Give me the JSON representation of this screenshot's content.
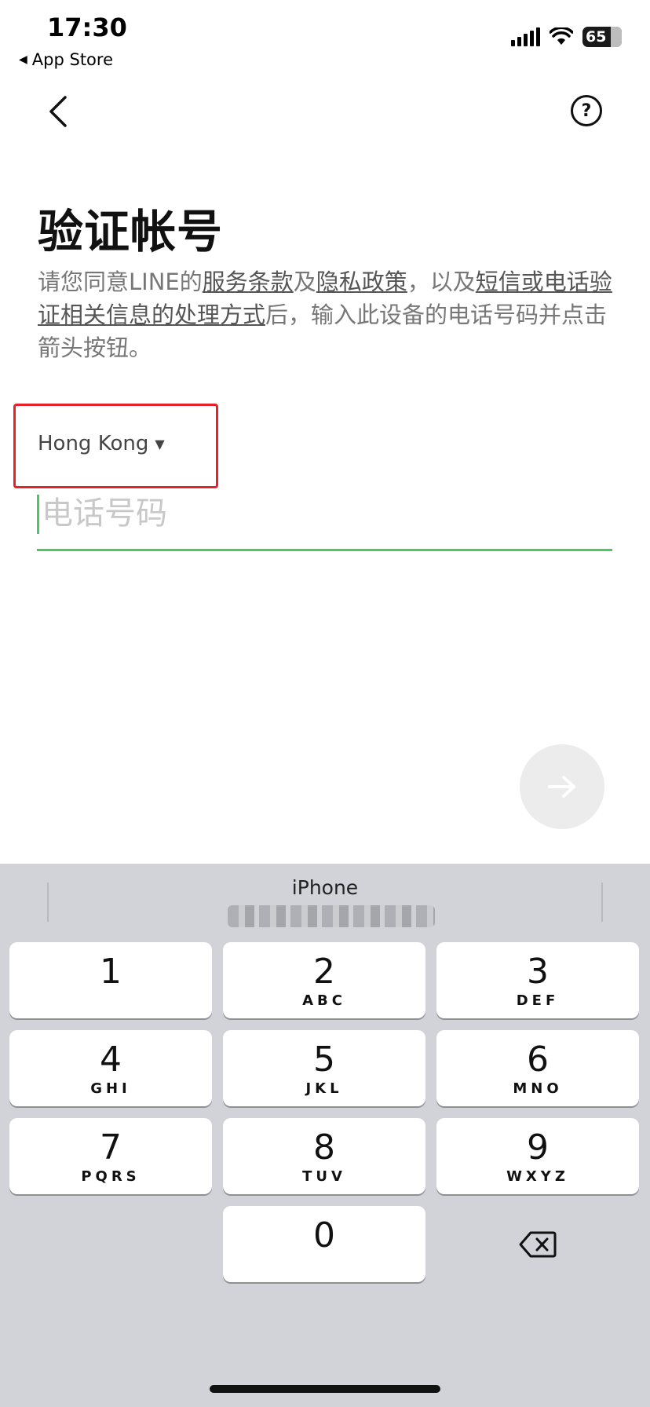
{
  "status_bar": {
    "time": "17:30",
    "back_app": "App Store",
    "battery": "65"
  },
  "nav": {
    "back_icon": "chevron-left-icon",
    "help_label": "?"
  },
  "page": {
    "title": "验证帐号",
    "desc_1": "请您同意LINE的",
    "link_terms": "服务条款",
    "desc_2": "及",
    "link_privacy": "隐私政策",
    "desc_3": "，以及",
    "link_sms": "短信或电话验证相关信息的处理方式",
    "desc_4": "后，输入此设备的电话号码并点击箭头按钮。"
  },
  "country": {
    "selected": "Hong Kong",
    "arrow": "▼"
  },
  "phone": {
    "placeholder": "电话号码",
    "value": ""
  },
  "colors": {
    "accent": "#4cc764",
    "highlight": "#e8202a"
  },
  "keyboard": {
    "suggestion_title": "iPhone",
    "keys": [
      {
        "digit": "1",
        "letters": ""
      },
      {
        "digit": "2",
        "letters": "ABC"
      },
      {
        "digit": "3",
        "letters": "DEF"
      },
      {
        "digit": "4",
        "letters": "GHI"
      },
      {
        "digit": "5",
        "letters": "JKL"
      },
      {
        "digit": "6",
        "letters": "MNO"
      },
      {
        "digit": "7",
        "letters": "PQRS"
      },
      {
        "digit": "8",
        "letters": "TUV"
      },
      {
        "digit": "9",
        "letters": "WXYZ"
      },
      {
        "digit": "0",
        "letters": ""
      }
    ],
    "delete_icon": "backspace-icon"
  }
}
